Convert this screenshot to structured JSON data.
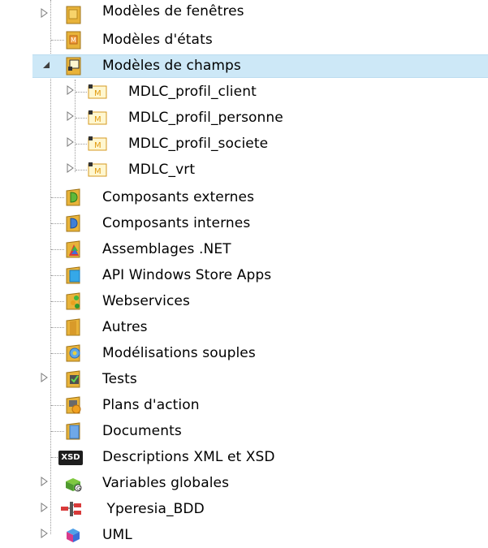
{
  "tree": {
    "items": [
      {
        "label": "Modèles de fenêtres",
        "icon": "window-template-folder-icon",
        "expander": "collapsed"
      },
      {
        "label": "Modèles d'états",
        "icon": "report-template-folder-icon",
        "expander": "none"
      },
      {
        "label": "Modèles de champs",
        "icon": "control-template-folder-icon",
        "expander": "expanded",
        "selected": true
      },
      {
        "label": "MDLC_profil_client",
        "icon": "control-template-icon",
        "expander": "collapsed",
        "child": true
      },
      {
        "label": "MDLC_profil_personne",
        "icon": "control-template-icon",
        "expander": "collapsed",
        "child": true
      },
      {
        "label": "MDLC_profil_societe",
        "icon": "control-template-icon",
        "expander": "collapsed",
        "child": true
      },
      {
        "label": "MDLC_vrt",
        "icon": "control-template-icon",
        "expander": "collapsed",
        "child": true
      },
      {
        "label": "Composants externes",
        "icon": "external-component-folder-icon",
        "expander": "none"
      },
      {
        "label": "Composants internes",
        "icon": "internal-component-folder-icon",
        "expander": "none"
      },
      {
        "label": "Assemblages .NET",
        "icon": "dotnet-assembly-folder-icon",
        "expander": "none"
      },
      {
        "label": "API Windows Store Apps",
        "icon": "windows-store-api-folder-icon",
        "expander": "none"
      },
      {
        "label": "Webservices",
        "icon": "webservices-folder-icon",
        "expander": "none"
      },
      {
        "label": "Autres",
        "icon": "other-folder-icon",
        "expander": "none"
      },
      {
        "label": "Modélisations souples",
        "icon": "flexible-modeling-folder-icon",
        "expander": "none"
      },
      {
        "label": "Tests",
        "icon": "tests-folder-icon",
        "expander": "collapsed"
      },
      {
        "label": "Plans d'action",
        "icon": "action-plan-folder-icon",
        "expander": "none"
      },
      {
        "label": "Documents",
        "icon": "documents-folder-icon",
        "expander": "none"
      },
      {
        "label": "Descriptions XML et XSD",
        "icon": "xsd-icon",
        "icon_text": "XSD",
        "expander": "none"
      },
      {
        "label": "Variables globales",
        "icon": "global-variables-icon",
        "expander": "collapsed"
      },
      {
        "label": " Yperesia_BDD",
        "icon": "database-analysis-icon",
        "expander": "collapsed"
      },
      {
        "label": "UML",
        "icon": "uml-icon",
        "expander": "collapsed"
      }
    ]
  },
  "colors": {
    "selection": "#cde8f7",
    "folder": "#e8b33a",
    "template_accent": "#e0a020",
    "connector": "#9a9a9a"
  }
}
